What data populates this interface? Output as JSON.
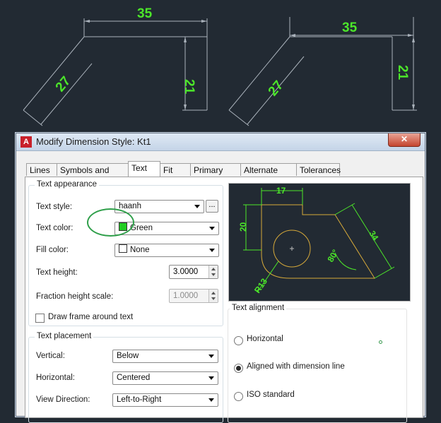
{
  "drawing": {
    "left": {
      "top": "35",
      "side": "21",
      "slant": "27"
    },
    "right": {
      "top": "35",
      "side": "21",
      "slant": "27"
    }
  },
  "dialog": {
    "title": "Modify Dimension Style: Kt1",
    "close_symbol": "✕",
    "app_icon": "A",
    "tabs": [
      "Lines",
      "Symbols and Arrows",
      "Text",
      "Fit",
      "Primary Units",
      "Alternate Units",
      "Tolerances"
    ],
    "active_tab": "Text"
  },
  "text_appearance": {
    "title": "Text appearance",
    "style_label": "Text style:",
    "style_value": "haanh",
    "browse_label": "...",
    "color_label": "Text color:",
    "color_value": "Green",
    "color_swatch": "#22cc22",
    "fill_label": "Fill color:",
    "fill_value": "None",
    "height_label": "Text height:",
    "height_value": "3.0000",
    "fraction_label": "Fraction height scale:",
    "fraction_value": "1.0000",
    "frame_label": "Draw frame around text"
  },
  "text_placement": {
    "title": "Text placement",
    "vertical_label": "Vertical:",
    "vertical_value": "Below",
    "horizontal_label": "Horizontal:",
    "horizontal_value": "Centered",
    "view_label": "View Direction:",
    "view_value": "Left-to-Right"
  },
  "preview": {
    "d17": "17",
    "d20": "20",
    "d34": "34",
    "d80": "80°",
    "r13": "R13"
  },
  "alignment": {
    "title": "Text alignment",
    "options": [
      "Horizontal",
      "Aligned with dimension line",
      "ISO standard"
    ],
    "selected": "Aligned with dimension line"
  },
  "colors": {
    "cad_bg": "#222a33",
    "dim_green": "#4ce62a",
    "dim_line": "#9aa3ad",
    "preview_yellow": "#d6a93a"
  }
}
